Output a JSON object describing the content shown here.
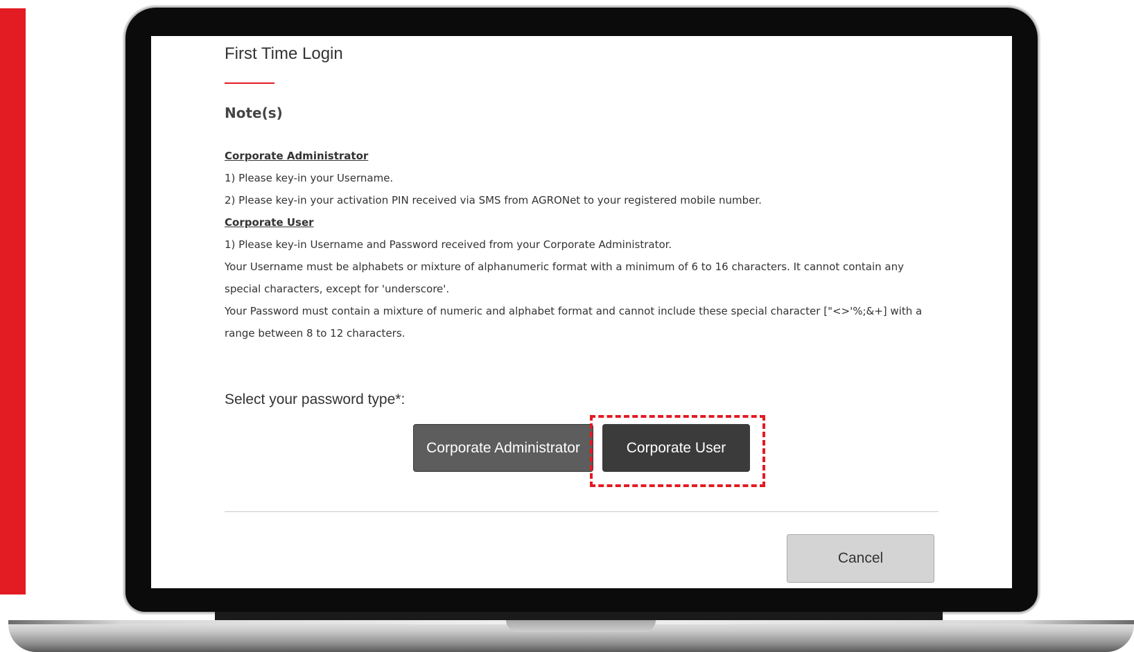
{
  "page": {
    "title": "First Time Login"
  },
  "notes": {
    "heading": "Note(s)",
    "admin_heading": "Corporate Administrator",
    "admin_items": [
      "1) Please key-in your Username.",
      "2) Please key-in your activation PIN received via SMS from AGRONet to your registered mobile number."
    ],
    "user_heading": "Corporate User",
    "user_items": [
      "1) Please key-in Username and Password received from your Corporate Administrator.",
      "Your Username must be alphabets or mixture of alphanumeric format with a minimum of 6 to 16 characters. It cannot contain any special characters, except for 'underscore'.",
      "Your Password must contain a mixture of numeric and alphabet format and cannot include these special character [\"<>'%;&+] with a range between 8 to 12 characters."
    ]
  },
  "password_type": {
    "label": "Select your password type*:",
    "admin_button": "Corporate Administrator",
    "user_button": "Corporate User"
  },
  "footer": {
    "cancel_label": "Cancel"
  },
  "colors": {
    "accent": "#e31b23",
    "admin_button": "#5d5d5d",
    "user_button": "#3b3b3b",
    "cancel_button": "#d4d4d4"
  }
}
